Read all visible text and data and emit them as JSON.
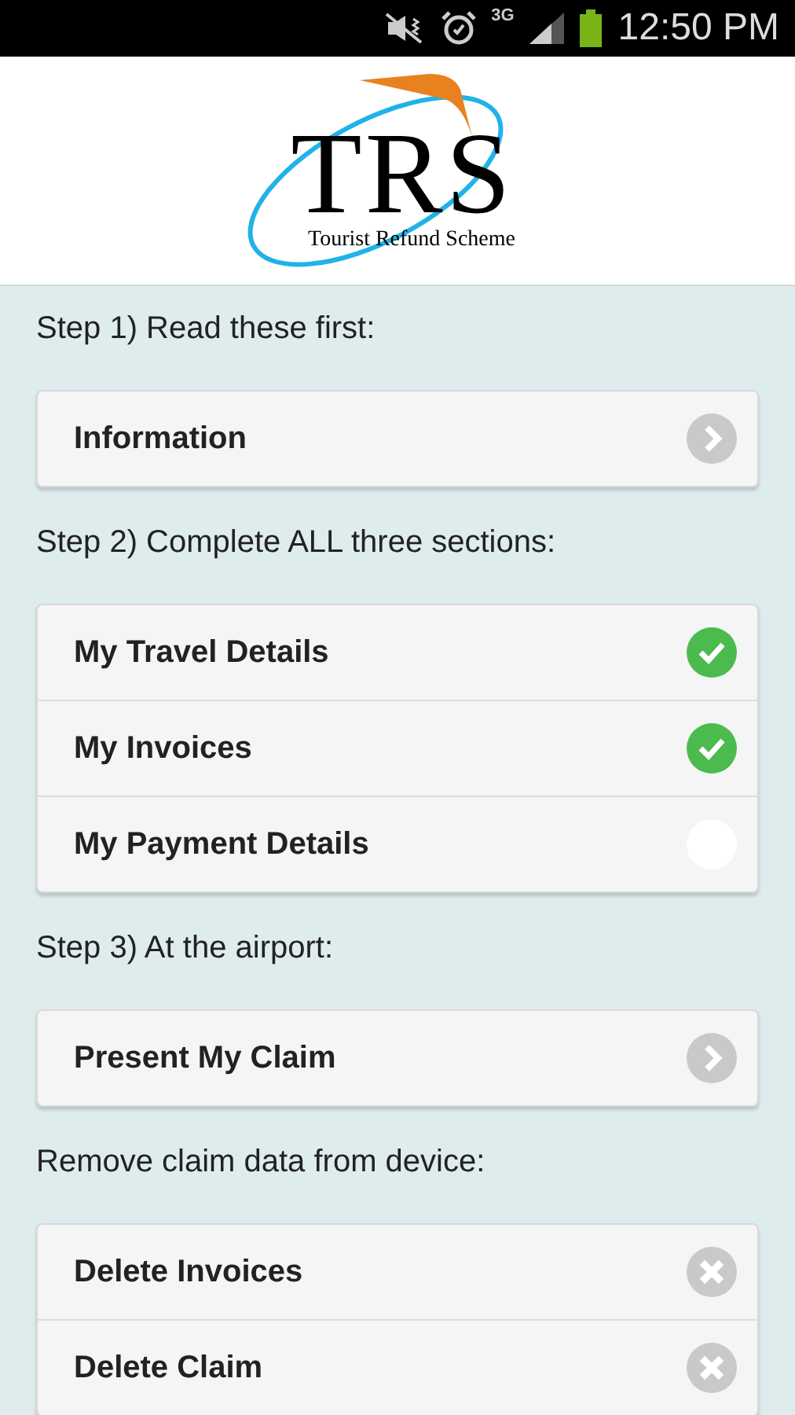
{
  "status_bar": {
    "network": "3G",
    "time": "12:50 PM"
  },
  "logo": {
    "title": "TRS",
    "subtitle": "Tourist Refund Scheme"
  },
  "sections": [
    {
      "heading": "Step 1) Read these first:",
      "items": [
        {
          "label": "Information",
          "kind": "arrow"
        }
      ]
    },
    {
      "heading": "Step 2) Complete ALL three sections:",
      "items": [
        {
          "label": "My Travel Details",
          "kind": "check",
          "checked": true
        },
        {
          "label": "My Invoices",
          "kind": "check",
          "checked": true
        },
        {
          "label": "My Payment Details",
          "kind": "check",
          "checked": false
        }
      ]
    },
    {
      "heading": "Step 3) At the airport:",
      "items": [
        {
          "label": "Present My Claim",
          "kind": "arrow"
        }
      ]
    },
    {
      "heading": "Remove claim data from device:",
      "items": [
        {
          "label": "Delete Invoices",
          "kind": "delete"
        },
        {
          "label": "Delete Claim",
          "kind": "delete"
        }
      ]
    }
  ]
}
